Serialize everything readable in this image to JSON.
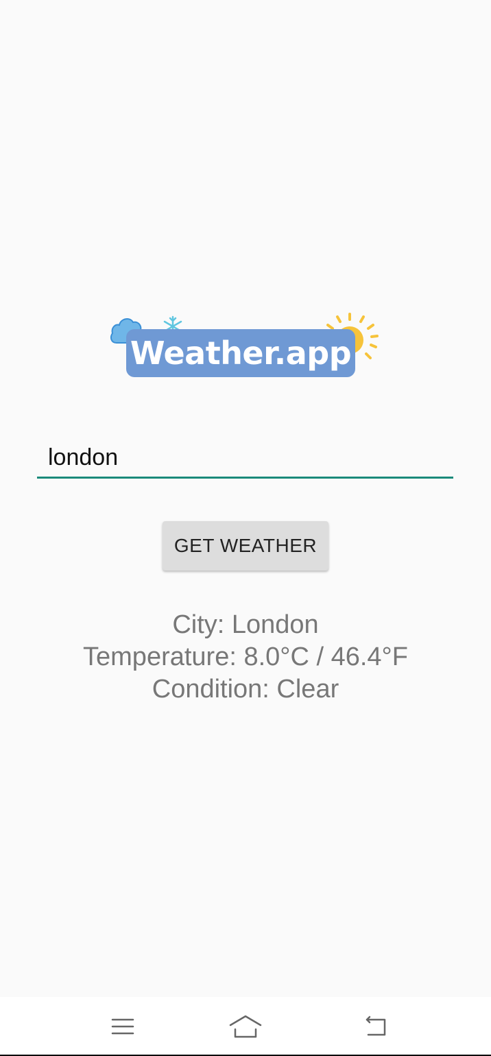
{
  "app": {
    "logo_text": "Weather.app"
  },
  "search": {
    "value": "london",
    "placeholder": ""
  },
  "button": {
    "label": "GET WEATHER"
  },
  "result": {
    "city": "City: London",
    "temperature": "Temperature: 8.0°C / 46.4°F",
    "condition": "Condition: Clear"
  },
  "navbar": {
    "icons": [
      "menu-icon",
      "home-icon",
      "back-icon"
    ]
  },
  "colors": {
    "background": "#fafafa",
    "accent": "#1a8a7a",
    "logo_box": "#6f99d4",
    "button_bg": "#dddddd",
    "result_text": "#777777"
  }
}
